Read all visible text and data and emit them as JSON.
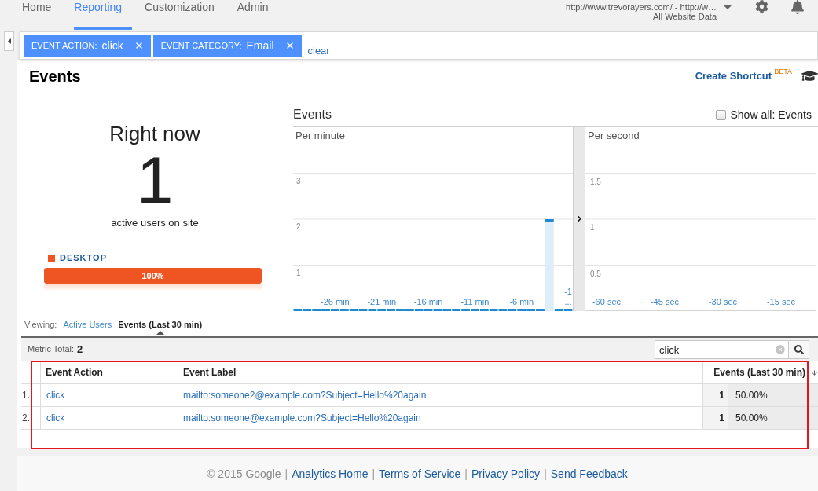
{
  "nav": {
    "tabs": [
      {
        "label": "Home",
        "selected": false
      },
      {
        "label": "Reporting",
        "selected": true
      },
      {
        "label": "Customization",
        "selected": false
      },
      {
        "label": "Admin",
        "selected": false
      }
    ],
    "account": {
      "property": "http://www.trevorayers.com/ - http://w…",
      "view": "All Website Data"
    }
  },
  "filters": {
    "chips": [
      {
        "label": "EVENT ACTION:",
        "value": "click"
      },
      {
        "label": "EVENT CATEGORY:",
        "value": "Email"
      }
    ],
    "clear": "clear"
  },
  "page": {
    "title": "Events",
    "shortcut": "Create Shortcut",
    "shortcut_badge": "BETA"
  },
  "right_now": {
    "heading": "Right now",
    "count": "1",
    "caption": "active users on site",
    "devices": [
      {
        "name": "DESKTOP",
        "color": "#ee5522",
        "level": 1,
        "reading": "100%"
      }
    ]
  },
  "events_panel": {
    "title": "Events",
    "show_all": {
      "label": "Show all: Events",
      "checked": false
    },
    "per_minute": {
      "chart_data": {
        "type": "bar",
        "title": "Per minute",
        "x": [
          -30,
          -29,
          -28,
          -27,
          -26,
          -25,
          -24,
          -23,
          -22,
          -21,
          -20,
          -19,
          -18,
          -17,
          -16,
          -15,
          -14,
          -13,
          -12,
          -11,
          -10,
          -9,
          -8,
          -7,
          -6,
          -5,
          -4,
          -3,
          -2,
          -1
        ],
        "series": [
          {
            "color": "#1f8ad2",
            "values": [
              0,
              0,
              0,
              0,
              0,
              0,
              0,
              0,
              0,
              0,
              0,
              0,
              0,
              0,
              0,
              0,
              0,
              0,
              0,
              0,
              0,
              0,
              0,
              0,
              0,
              0,
              0,
              2,
              0,
              0
            ]
          }
        ],
        "xlim": [
          -30.5,
          -0.5
        ],
        "ylim": [
          0,
          3
        ],
        "grid": true,
        "yticks": [
          1,
          2,
          3
        ],
        "xticks": [
          {
            "value": -26,
            "label": "-26 min"
          },
          {
            "value": -21,
            "label": "-21 min"
          },
          {
            "value": -16,
            "label": "-16 min"
          },
          {
            "value": -11,
            "label": "-11 min"
          },
          {
            "value": -6,
            "label": "-6 min"
          },
          {
            "value": -1,
            "label": "-1 ..."
          }
        ]
      }
    },
    "per_second": {
      "title": "Per second",
      "y_axis_labels": [
        "1.5",
        "1",
        "0.5"
      ],
      "x_axis_labels": [
        "-60 sec",
        "-45 sec",
        "-30 sec",
        "-15 sec"
      ]
    }
  },
  "viewing": {
    "label": "Viewing:",
    "tabs": [
      {
        "label": "Active Users",
        "selected": false
      },
      {
        "label": "Events (Last 30 min)",
        "selected": true
      }
    ]
  },
  "table": {
    "metric_total_label": "Metric Total:",
    "metric_total": "2",
    "search": {
      "value": "click"
    },
    "columns": [
      "Event Action",
      "Event Label",
      "Events (Last 30 min)"
    ],
    "rows": [
      {
        "index": "1.",
        "event_action": "click",
        "event_label": "mailto:someone2@example.com?Subject=Hello%20again",
        "events": "1",
        "share": "50.00%"
      },
      {
        "index": "2.",
        "event_action": "click",
        "event_label": "mailto:someone@example.com?Subject=Hello%20again",
        "events": "1",
        "share": "50.00%"
      }
    ]
  },
  "footer": {
    "copyright": "© 2015 Google",
    "separator": "|",
    "links": [
      "Analytics Home",
      "Terms of Service",
      "Privacy Policy",
      "Send Feedback"
    ]
  }
}
